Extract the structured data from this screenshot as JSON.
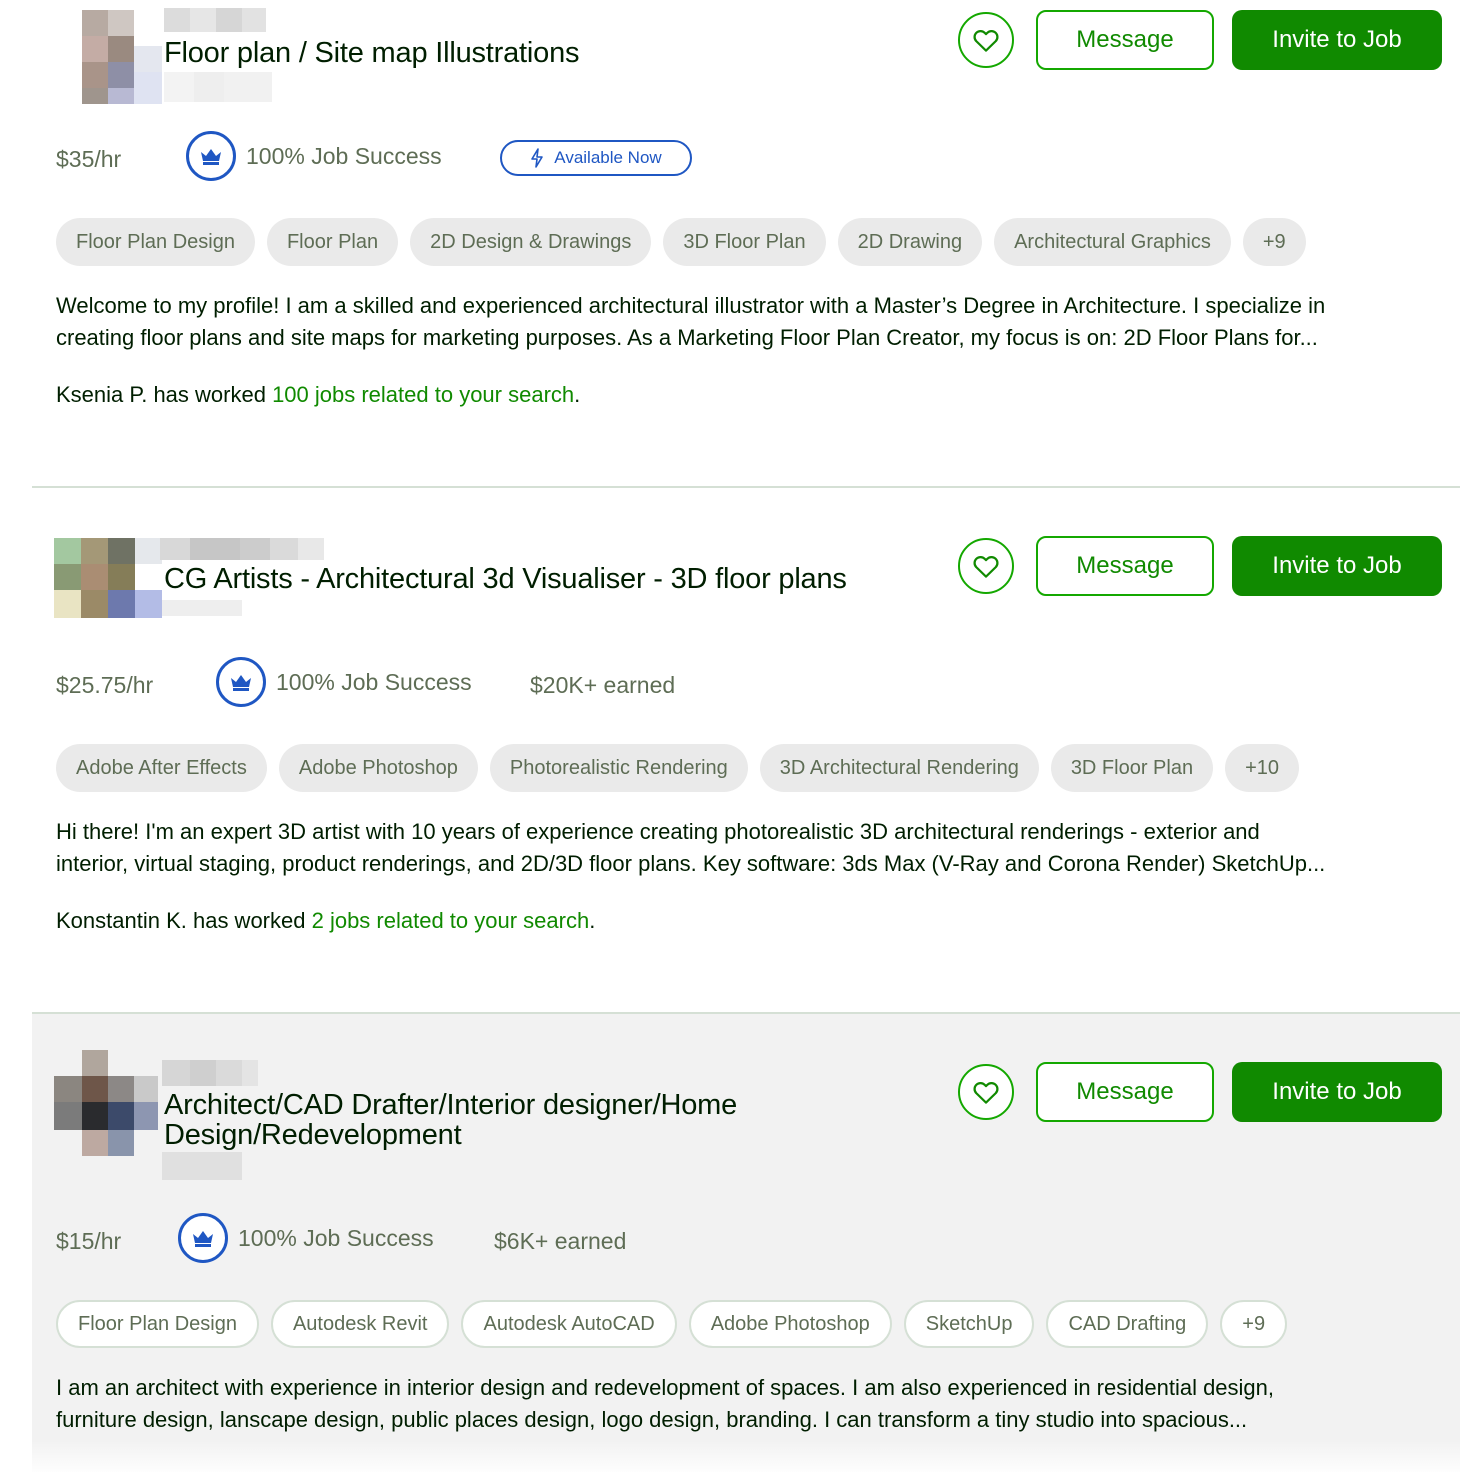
{
  "buttons": {
    "message": "Message",
    "invite": "Invite to Job"
  },
  "colors": {
    "brand_green": "#108a00",
    "badge_blue": "#1f57c3",
    "muted_text": "#5e6d55"
  },
  "freelancers": [
    {
      "title": "Floor plan / Site map Illustrations",
      "rate": "$35/hr",
      "job_success": "100% Job Success",
      "availability": "Available Now",
      "skills": [
        "Floor Plan Design",
        "Floor Plan",
        "2D Design & Drawings",
        "3D Floor Plan",
        "2D Drawing",
        "Architectural Graphics",
        "+9"
      ],
      "description_line1": "Welcome to my profile! I am a skilled and experienced architectural illustrator with a Master’s Degree in Architecture. I specialize in",
      "description_line2": "creating floor plans and site maps for marketing purposes. As a Marketing Floor Plan Creator, my focus is on: 2D Floor Plans for...",
      "worked_prefix": "Ksenia P. has worked ",
      "worked_link": "100 jobs related to your search",
      "worked_suffix": "."
    },
    {
      "title": "CG Artists - Architectural 3d Visualiser - 3D floor plans",
      "rate": "$25.75/hr",
      "job_success": "100% Job Success",
      "earned": "$20K+ earned",
      "skills": [
        "Adobe After Effects",
        "Adobe Photoshop",
        "Photorealistic Rendering",
        "3D Architectural Rendering",
        "3D Floor Plan",
        "+10"
      ],
      "description_line1": "Hi there! I'm an expert 3D artist with 10 years of experience creating photorealistic 3D architectural renderings - exterior and",
      "description_line2": "interior, virtual staging, product renderings, and 2D/3D floor plans. Key software: 3ds Max (V-Ray and Corona Render) SketchUp...",
      "worked_prefix": "Konstantin K. has worked ",
      "worked_link": "2 jobs related to your search",
      "worked_suffix": "."
    },
    {
      "title_line1": "Architect/CAD Drafter/Interior designer/Home",
      "title_line2": "Design/Redevelopment",
      "rate": "$15/hr",
      "job_success": "100% Job Success",
      "earned": "$6K+ earned",
      "skills": [
        "Floor Plan Design",
        "Autodesk Revit",
        "Autodesk AutoCAD",
        "Adobe Photoshop",
        "SketchUp",
        "CAD Drafting",
        "+9"
      ],
      "description_line1": "I am an architect with experience in interior design and redevelopment of spaces. I am also experienced in residential design,",
      "description_line2": "furniture design, lanscape design, public places design, logo design, branding. I can transform a tiny studio into spacious..."
    }
  ]
}
